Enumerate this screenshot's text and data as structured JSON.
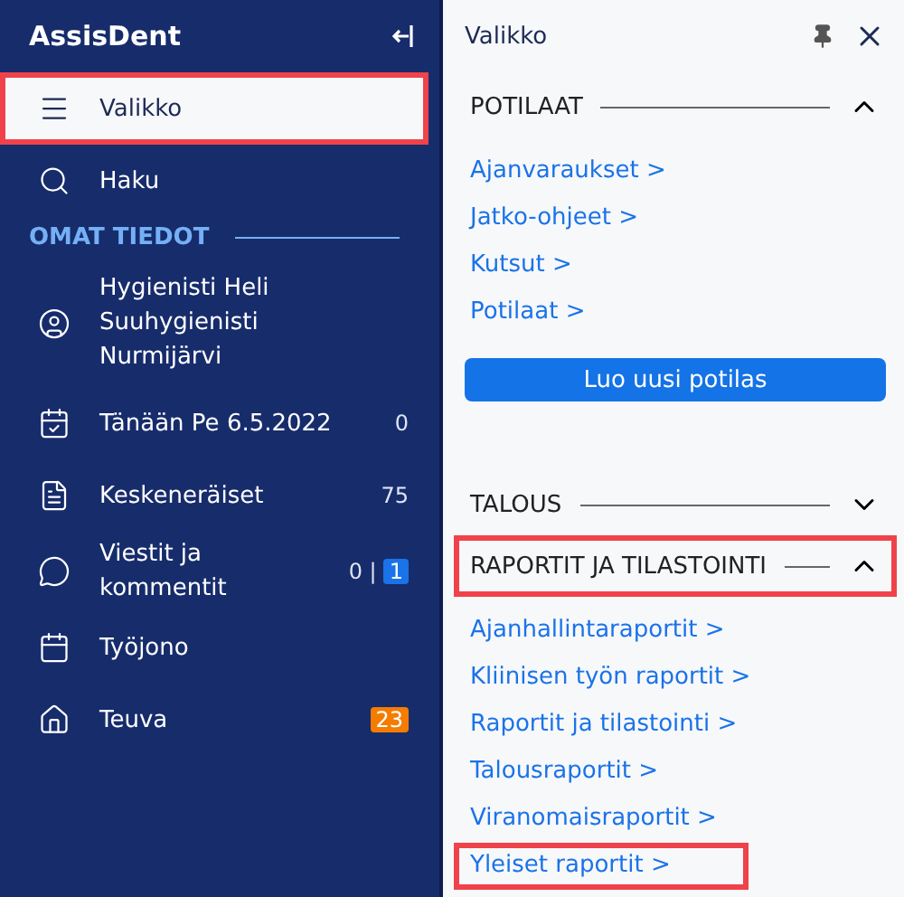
{
  "sidebar": {
    "app_name": "AssisDent",
    "items": [
      {
        "kind": "nav",
        "label": "Valikko",
        "selected": true,
        "highlighted": true
      },
      {
        "kind": "nav",
        "label": "Haku",
        "selected": false,
        "highlighted": false
      },
      {
        "kind": "heading",
        "label": "OMAT TIEDOT"
      },
      {
        "kind": "nav",
        "label": "Hygienisti Heli Suuhygienisti Nurmijärvi",
        "selected": false,
        "highlighted": false
      },
      {
        "kind": "nav",
        "label": "Tänään Pe 6.5.2022",
        "selected": false,
        "highlighted": false,
        "counts": [
          {
            "kind": "plain",
            "text": "0"
          }
        ]
      },
      {
        "kind": "nav",
        "label": "Keskeneräiset",
        "selected": false,
        "highlighted": false,
        "counts": [
          {
            "kind": "plain",
            "text": "75"
          }
        ]
      },
      {
        "kind": "nav",
        "label": "Viestit ja kommentit",
        "selected": false,
        "highlighted": false,
        "counts": [
          {
            "kind": "plain",
            "text": "0 |"
          },
          {
            "kind": "badge",
            "text": "1",
            "color": "#1a73e8"
          }
        ]
      },
      {
        "kind": "nav",
        "label": "Työjono",
        "selected": false,
        "highlighted": false
      },
      {
        "kind": "nav",
        "label": "Teuva",
        "selected": false,
        "highlighted": false,
        "counts": [
          {
            "kind": "badge",
            "text": "23",
            "color": "#f57c00"
          }
        ]
      }
    ]
  },
  "panel": {
    "title": "Valikko",
    "sections": [
      {
        "title": "POTILAAT",
        "expanded": true,
        "highlighted": false,
        "links": [
          {
            "label": "Ajanvaraukset >",
            "highlighted": false
          },
          {
            "label": "Jatko-ohjeet >",
            "highlighted": false
          },
          {
            "label": "Kutsut >",
            "highlighted": false
          },
          {
            "label": "Potilaat >",
            "highlighted": false
          }
        ],
        "button": "Luo uusi potilas"
      },
      {
        "title": "TALOUS",
        "expanded": false,
        "highlighted": false
      },
      {
        "title": "RAPORTIT JA TILASTOINTI",
        "expanded": true,
        "highlighted": true,
        "links": [
          {
            "label": "Ajanhallintaraportit >",
            "highlighted": false
          },
          {
            "label": "Kliinisen työn raportit >",
            "highlighted": false
          },
          {
            "label": "Raportit ja tilastointi >",
            "highlighted": false
          },
          {
            "label": "Talousraportit >",
            "highlighted": false
          },
          {
            "label": "Viranomaisraportit >",
            "highlighted": false
          },
          {
            "label": "Yleiset raportit >",
            "highlighted": true
          }
        ]
      }
    ]
  }
}
